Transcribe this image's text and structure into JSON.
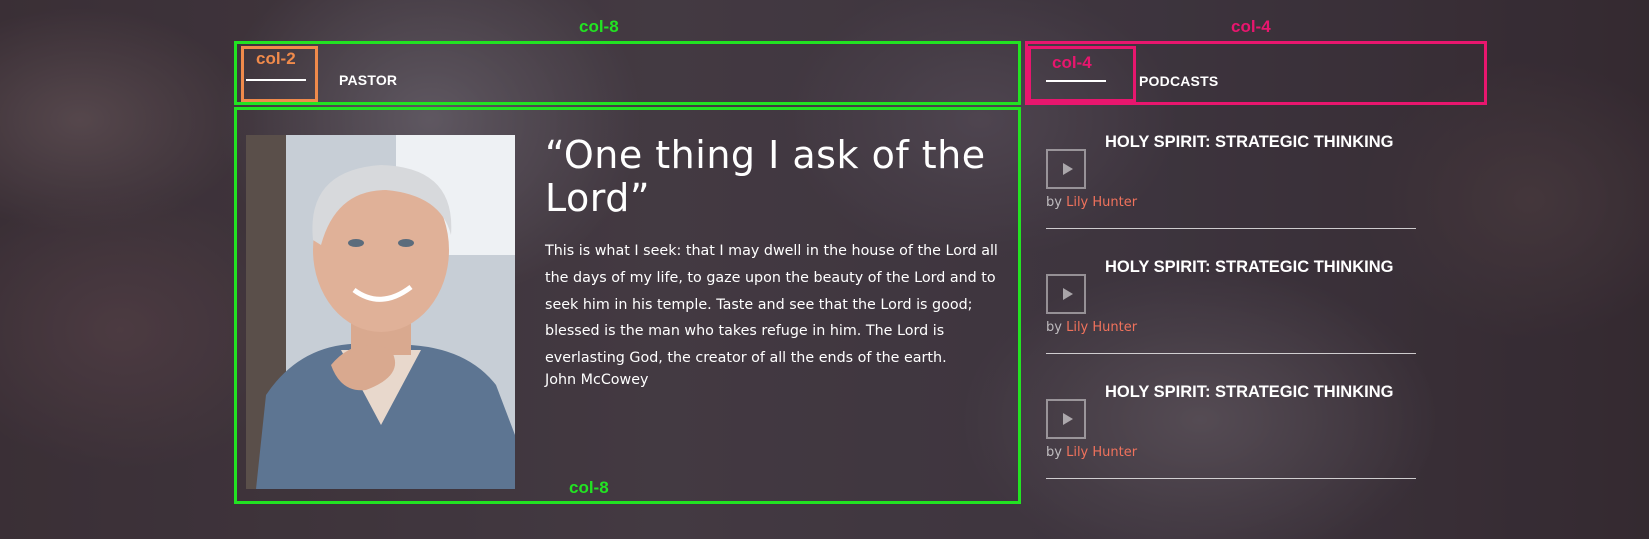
{
  "grid_labels": {
    "left_top": "col-8",
    "right_top": "col-4",
    "left_inner": "col-2",
    "right_inner": "col-4",
    "left_bottom": "col-8"
  },
  "colors": {
    "green_outline": "#22e322",
    "orange_outline": "#f08a4b",
    "pink_outline": "#e8166e",
    "author_link": "#f0725c"
  },
  "pastor": {
    "section_title": "PASTOR",
    "quote_title": "“One thing I ask of the Lord”",
    "quote_body": "This is what I seek: that I may dwell in the house of the Lord all the days of my life, to gaze upon the beauty of the Lord and to seek him in his temple. Taste and see that the Lord is good; blessed is the man who takes refuge in him. The Lord is everlasting God, the creator of all the ends of the earth.",
    "author": "John McCowey"
  },
  "podcasts": {
    "section_title": "PODCASTS",
    "items": [
      {
        "title": "HOLY SPIRIT: STRATEGIC THINKING",
        "by": "by",
        "author": "Lily Hunter",
        "icon": "play-icon"
      },
      {
        "title": "HOLY SPIRIT: STRATEGIC THINKING",
        "by": "by",
        "author": "Lily Hunter",
        "icon": "play-icon"
      },
      {
        "title": "HOLY SPIRIT: STRATEGIC THINKING",
        "by": "by",
        "author": "Lily Hunter",
        "icon": "play-icon"
      }
    ]
  }
}
